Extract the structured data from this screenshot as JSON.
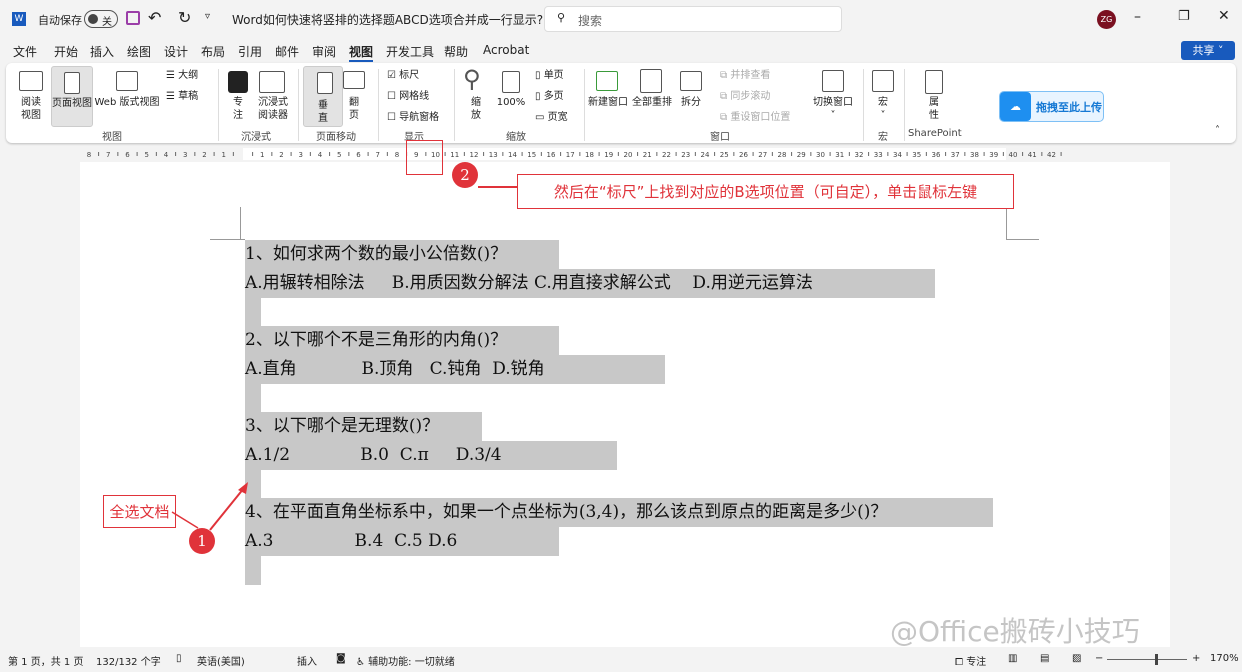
{
  "titlebar": {
    "autosave": "自动保存",
    "toggle": "关",
    "title": "Word如何快速将竖排的选择题ABCD选项合并成一行显示? .d...",
    "search_placeholder": "搜索",
    "avatar": "ZG"
  },
  "menu": [
    "文件",
    "开始",
    "插入",
    "绘图",
    "设计",
    "布局",
    "引用",
    "邮件",
    "审阅",
    "视图",
    "开发工具",
    "帮助",
    "Acrobat"
  ],
  "share": "共享",
  "ribbon": {
    "read_view": "阅读\n视图",
    "print_layout": "页面视图",
    "web_layout": "Web 版式视图",
    "outline": "大纲",
    "draft": "草稿",
    "group_views": "视图",
    "focus": "专\n注",
    "immersive_reader": "沉浸式\n阅读器",
    "group_immersive": "沉浸式",
    "vertical": "垂\n直",
    "side_to_side": "翻\n页",
    "group_page_movement": "页面移动",
    "ruler": "标尺",
    "gridlines": "网格线",
    "nav_pane": "导航窗格",
    "group_show": "显示",
    "zoom": "缩\n放",
    "zoom100": "100%",
    "one_page": "单页",
    "multi_page": "多页",
    "page_width": "页宽",
    "group_zoom": "缩放",
    "new_window": "新建窗口",
    "arrange_all": "全部重排",
    "split": "拆分",
    "side_by_side": "并排查看",
    "sync_scroll": "同步滚动",
    "reset_pos": "重设窗口位置",
    "switch_windows": "切换窗口",
    "group_window": "窗口",
    "macros": "宏",
    "group_macros": "宏",
    "properties": "属\n性",
    "group_sharepoint": "SharePoint",
    "upload": "拖拽至此上传"
  },
  "document": {
    "lines": [
      "1、如何求两个数的最小公倍数()？",
      "A.用辗转相除法     B.用质因数分解法 C.用直接求解公式    D.用逆元运算法",
      "",
      "2、以下哪个不是三角形的内角()？",
      "A.直角            B.顶角   C.钝角  D.锐角",
      "",
      "3、以下哪个是无理数()？",
      "A.1/2             B.0  C.π     D.3/4",
      "",
      "4、在平面直角坐标系中，如果一个点坐标为(3,4)，那么该点到原点的距离是多少()？",
      "A.3               B.4  C.5 D.6",
      ""
    ]
  },
  "annotations": {
    "step1_num": "1",
    "step1_text": "全选文档",
    "step2_num": "2",
    "step2_text": "然后在“标尺”上找到对应的B选项位置（可自定），单击鼠标左键",
    "watermark": "@Office搬砖小技巧"
  },
  "status": {
    "page": "第 1 页，共 1 页",
    "words": "132/132 个字",
    "language": "英语(美国)",
    "insert": "插入",
    "accessibility": "辅助功能: 一切就绪",
    "focus": "专注",
    "zoom": "170%"
  }
}
